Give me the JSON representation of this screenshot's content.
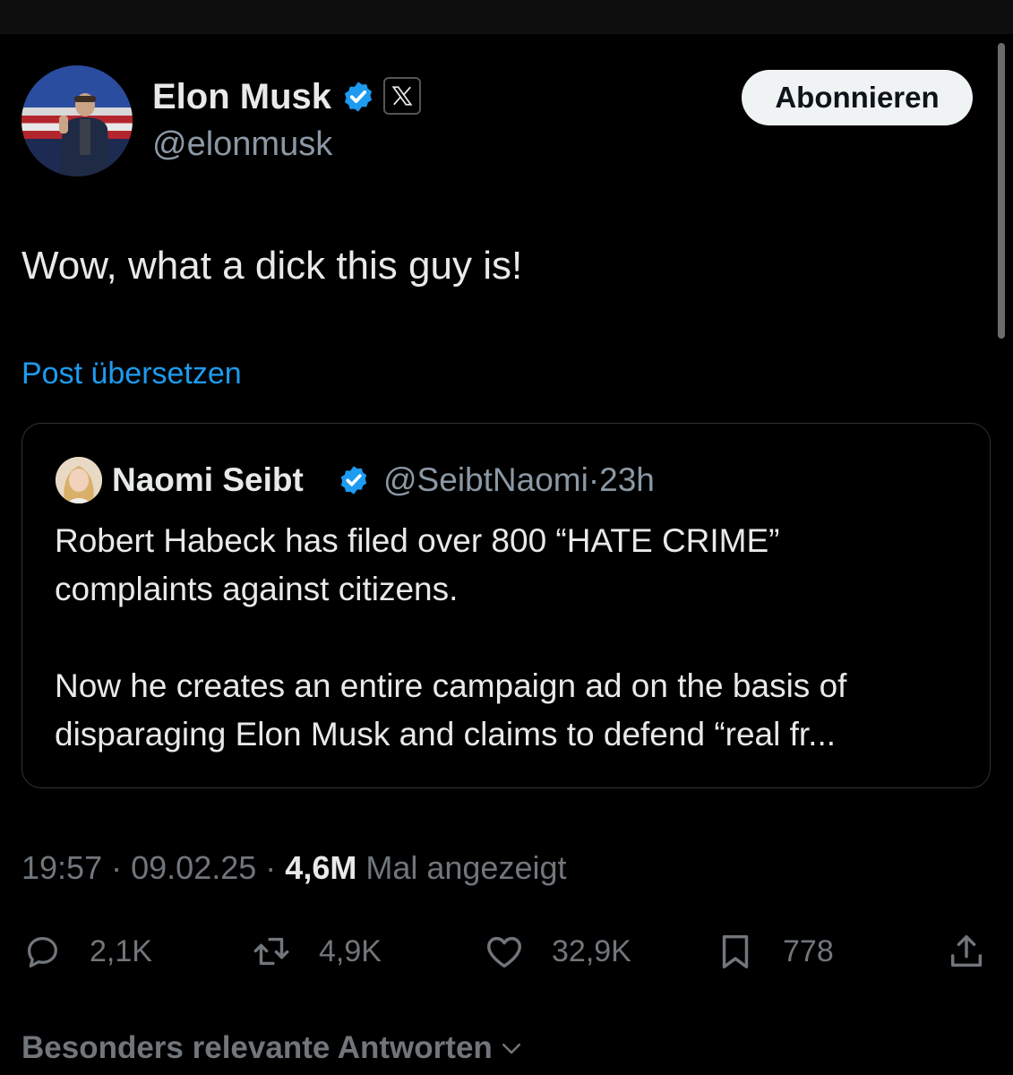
{
  "post": {
    "author": {
      "name": "Elon Musk",
      "handle": "@elonmusk",
      "verified": true,
      "affiliate_badge": "X"
    },
    "follow_label": "Abonnieren",
    "text": "Wow, what a dick this guy is!",
    "translate_label": "Post übersetzen",
    "quoted": {
      "name": "Naomi Seibt",
      "handle": "@SeibtNaomi",
      "separator": "·",
      "time": "23h",
      "verified": true,
      "lines": [
        "Robert Habeck has filed over 800 “HATE CRIME”",
        "complaints against citizens.",
        "Now he creates an entire campaign ad on the basis of",
        "disparaging Elon Musk and claims to defend “real fr..."
      ]
    },
    "meta": {
      "time": "19:57",
      "sep1": "·",
      "date": "09.02.25",
      "sep2": "·",
      "views": "4,6M",
      "views_label": "Mal angezeigt"
    },
    "actions": {
      "replies": "2,1K",
      "reposts": "4,9K",
      "likes": "32,9K",
      "bookmarks": "778"
    },
    "replies_sort_label": "Besonders relevante Antworten"
  },
  "icons": {
    "verified": "verified-badge-icon",
    "reply": "reply-icon",
    "repost": "repost-icon",
    "like": "heart-icon",
    "bookmark": "bookmark-icon",
    "share": "share-icon",
    "dropdown": "chevron-down-icon"
  },
  "colors": {
    "background": "#000000",
    "text": "#e7e9ea",
    "secondary_text": "#71767b",
    "link": "#1d9bf0",
    "verified": "#1d9bf0",
    "button_bg": "#eff3f4"
  }
}
